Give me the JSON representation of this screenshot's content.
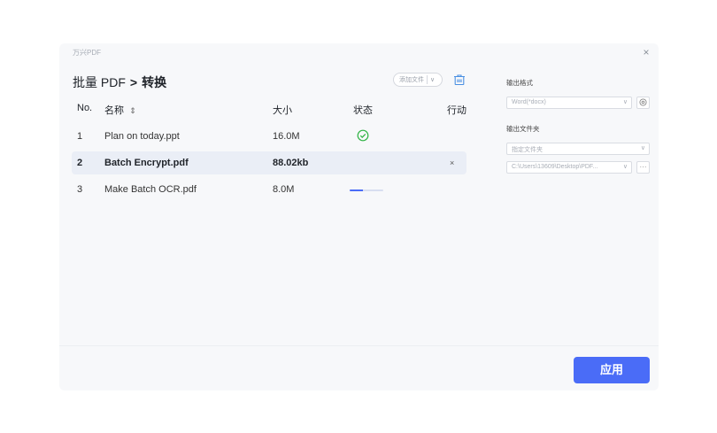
{
  "app": {
    "title": "万兴PDF",
    "close_glyph": "×"
  },
  "breadcrumb": {
    "root": "批量 PDF",
    "separator": ">",
    "current": "转换"
  },
  "toolbar": {
    "add_file_label": "添加文件",
    "add_file_chevron": "∨",
    "clear_icon": "trash-icon"
  },
  "table": {
    "headers": {
      "no": "No.",
      "name": "名称",
      "sort_icon": "⇕",
      "size": "大小",
      "status": "状态",
      "action": "行动"
    },
    "rows": [
      {
        "no": "1",
        "name": "Plan on today.ppt",
        "size": "16.0M",
        "status": "done"
      },
      {
        "no": "2",
        "name": "Batch Encrypt.pdf",
        "size": "88.02kb",
        "status": "selected",
        "action_glyph": "×"
      },
      {
        "no": "3",
        "name": "Make Batch OCR.pdf",
        "size": "8.0M",
        "status": "progress",
        "progress_fraction": 0.4
      }
    ]
  },
  "settings": {
    "output_format_label": "输出格式",
    "output_format_value": "Word(*docx)",
    "output_folder_label": "输出文件夹",
    "folder_mode_value": "指定文件夹",
    "folder_path_value": "C:\\Users\\13609\\Desktop\\PDF...",
    "more_glyph": "···"
  },
  "footer": {
    "apply_label": "应用"
  },
  "colors": {
    "accent": "#4a6cf7",
    "success": "#2fb344",
    "selected_row": "#eaeef6"
  }
}
